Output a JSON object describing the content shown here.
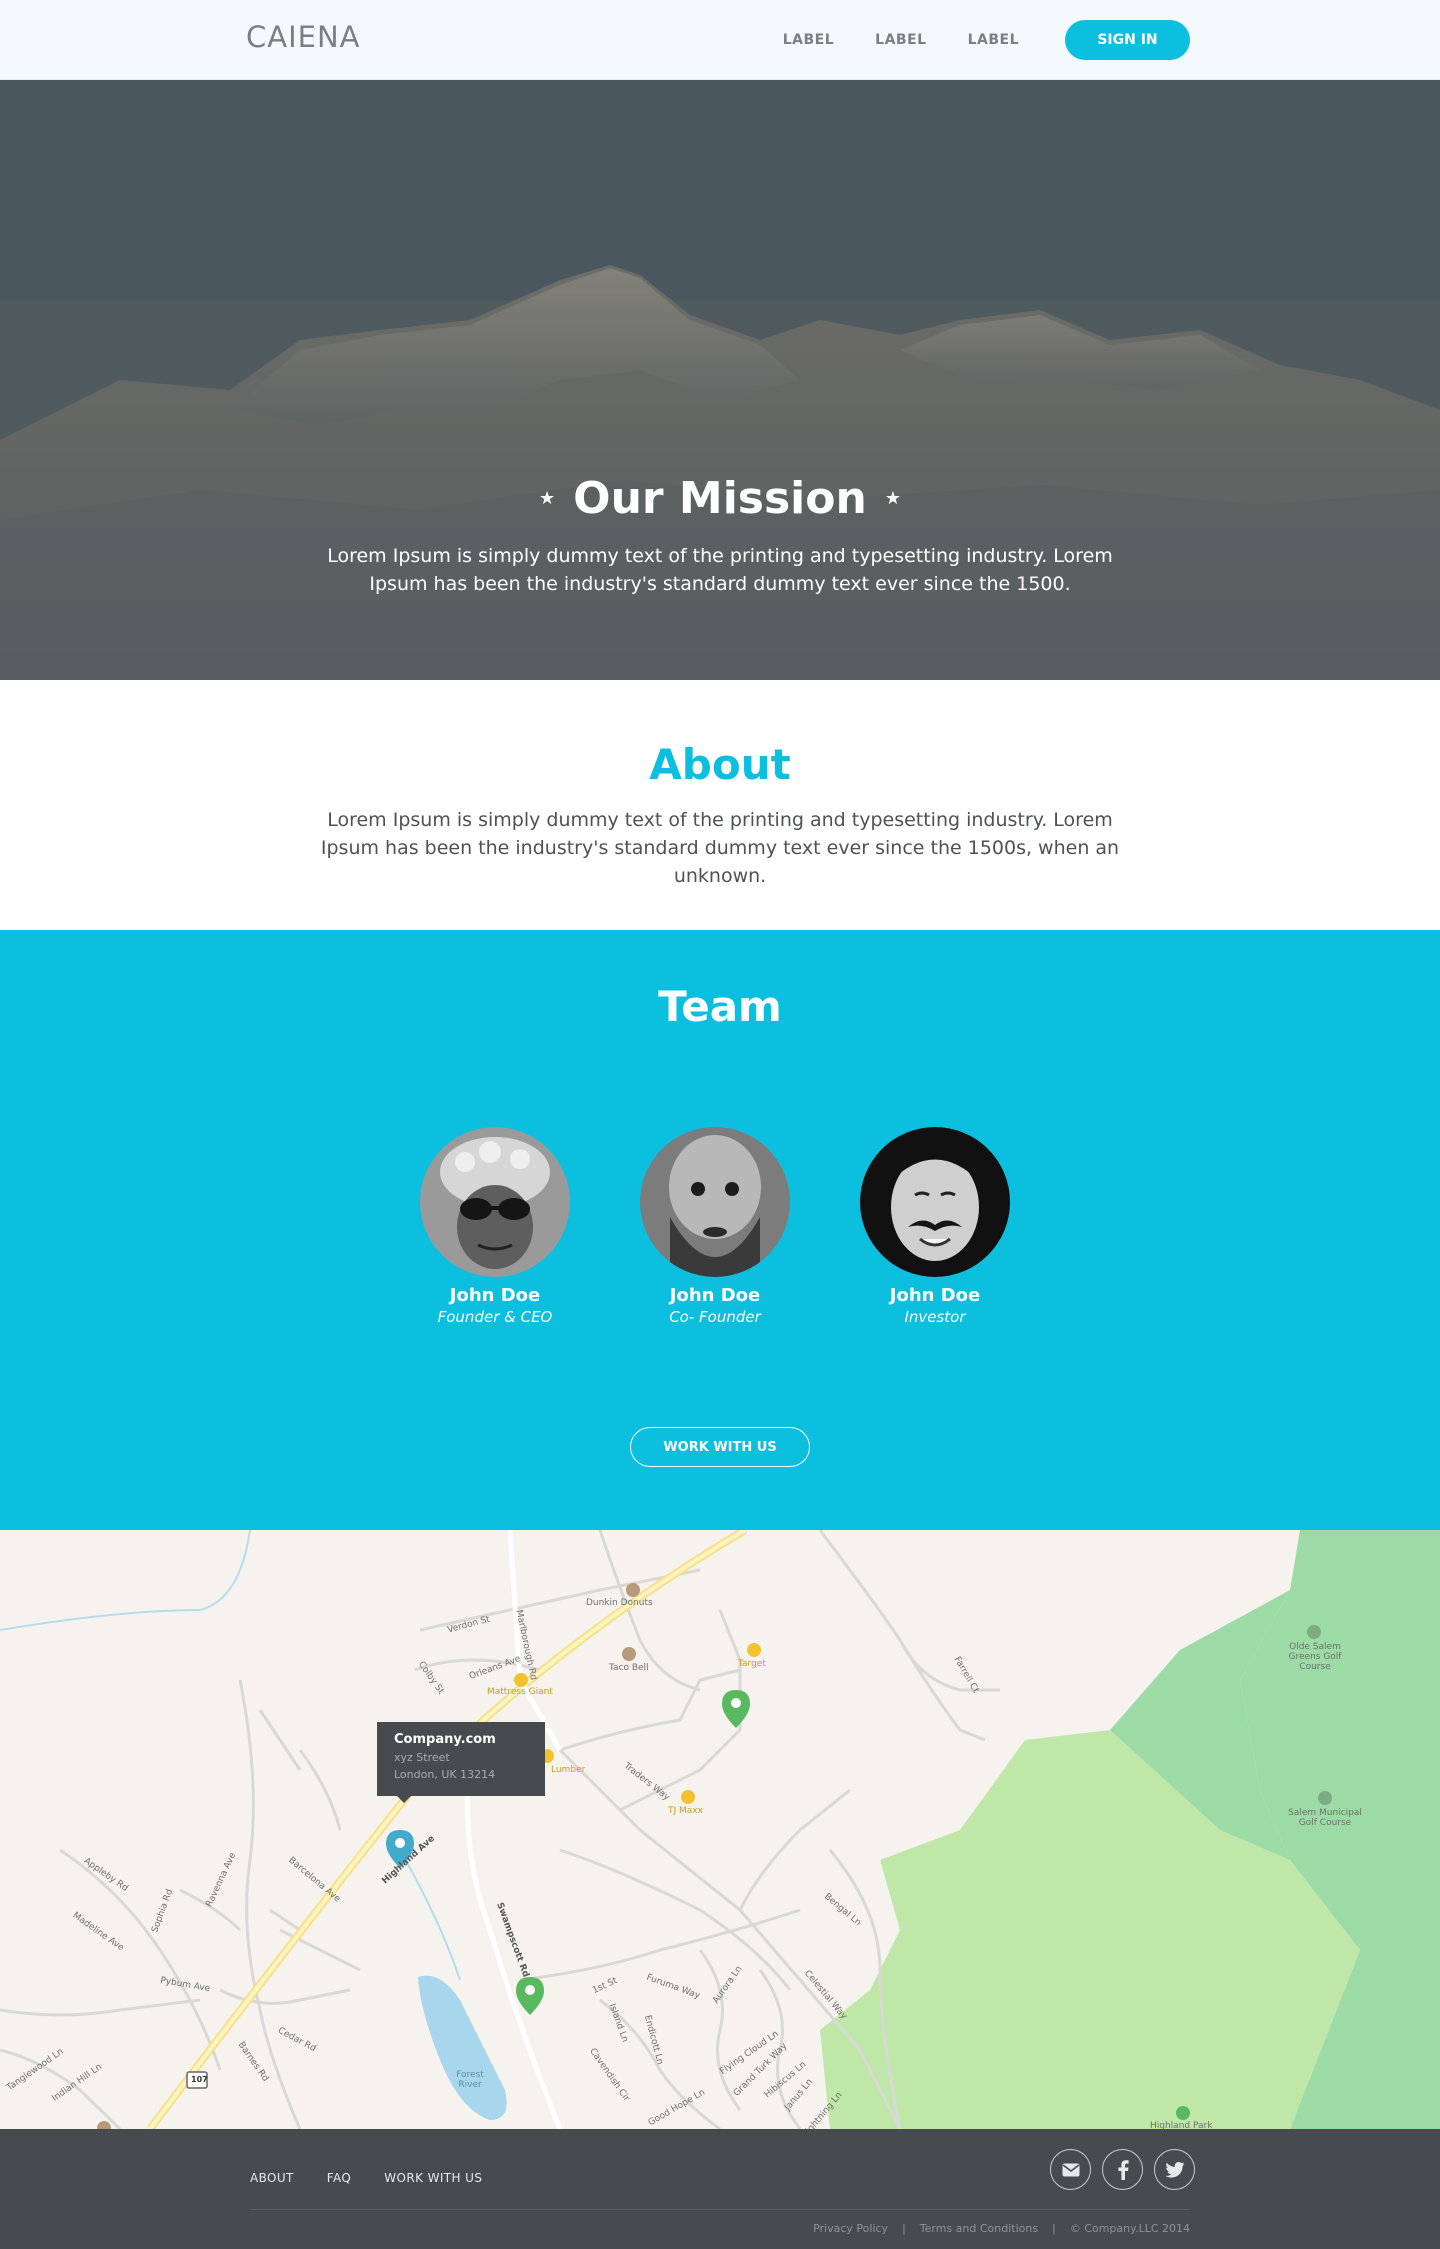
{
  "header": {
    "logo": "CAIENA",
    "nav": [
      "LABEL",
      "LABEL",
      "LABEL"
    ],
    "signin": "SIGN IN"
  },
  "hero": {
    "star": "★",
    "title": "Our Mission",
    "text": "Lorem Ipsum is simply dummy text of the printing and typesetting industry. Lorem Ipsum has been the industry's standard dummy text ever since the 1500."
  },
  "about": {
    "title": "About",
    "text": "Lorem Ipsum is simply dummy text of the printing and typesetting industry. Lorem Ipsum has been the industry's standard dummy text ever since the 1500s, when an unknown."
  },
  "team": {
    "title": "Team",
    "members": [
      {
        "name": "John Doe",
        "role": "Founder & CEO"
      },
      {
        "name": "John Doe",
        "role": "Co- Founder"
      },
      {
        "name": "John Doe",
        "role": "Investor"
      }
    ],
    "button": "WORK WITH US"
  },
  "map": {
    "tooltip": {
      "title": "Company.com",
      "street": "xyz Street",
      "city": "London, UK 13214"
    },
    "labels": {
      "dunkin": "Dunkin Donuts",
      "taco": "Taco Bell",
      "target": "Target",
      "mattress": "Mattress Giant",
      "lumber": "Lumber",
      "tjmaxx": "TJ Maxx",
      "olde_salem": "Olde Salem Greens Golf Course",
      "salem_muni": "Salem Municipal Golf Course",
      "highland": "Highland Ave",
      "marlborough": "Marlborough Rd",
      "swampscott": "Swampscott Rd",
      "verdon": "Verdon St",
      "orleans": "Orleans Ave",
      "colby": "Colby St",
      "traders": "Traders Way",
      "appleby": "Appleby Rd",
      "madeline": "Madeline Ave",
      "sophia": "Sophia Rd",
      "barcelona": "Barcelona Ave",
      "ravenna": "Ravenna Ave",
      "pybum": "Pybum Ave",
      "cedar": "Cedar Rd",
      "barnes": "Barnes Rd",
      "first_st": "1st St",
      "furuma": "Furuma Way",
      "aurora": "Aurora Ln",
      "celestial": "Celestial Way",
      "bengal": "Bengal Ln",
      "flying_cloud": "Flying Cloud Ln",
      "grand_turk": "Grand Turk Way",
      "forest_river": "Forest River",
      "route": "107",
      "tanglewood": "Tanglewood Ln",
      "indian_hill": "Indian Hill Ln",
      "highland_park": "Highland Park",
      "farrell": "Farrell Ct",
      "island": "Island Ln",
      "cavendish": "Cavendish Cir",
      "good_hope": "Good Hope Ln",
      "janus": "Janus Ln",
      "lightning": "Lightning Ln",
      "hibiscus": "Hibiscus Ln",
      "endicott": "Endicott Ln"
    }
  },
  "footer": {
    "links": [
      "ABOUT",
      "FAQ",
      "WORK WITH US"
    ],
    "privacy": "Privacy Policy",
    "sep": "|",
    "terms": "Terms and Conditions",
    "copyright": "© Company.LLC 2014"
  },
  "colors": {
    "accent": "#0dbfdf",
    "footer_bg": "#474b4e",
    "header_bg": "#f4f9fb"
  }
}
